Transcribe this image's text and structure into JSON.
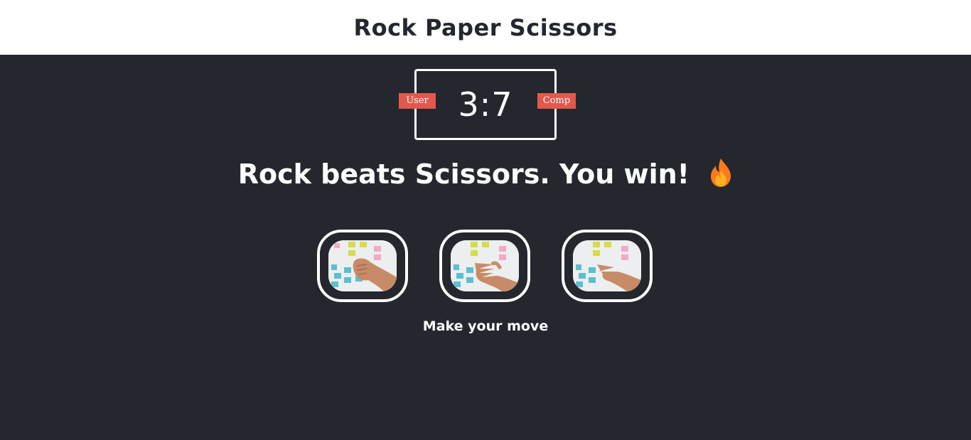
{
  "header": {
    "title": "Rock Paper Scissors"
  },
  "scoreboard": {
    "score": "3:7",
    "user_label": "User",
    "comp_label": "Comp"
  },
  "result": {
    "message": "Rock beats Scissors. You win!",
    "icon": "flame-icon"
  },
  "choices": [
    {
      "name": "rock"
    },
    {
      "name": "paper"
    },
    {
      "name": "scissors"
    }
  ],
  "action": {
    "message": "Make your move"
  },
  "colors": {
    "background": "#24272e",
    "header_bg": "#ffffff",
    "badge": "#e2584d",
    "text": "#ffffff"
  }
}
